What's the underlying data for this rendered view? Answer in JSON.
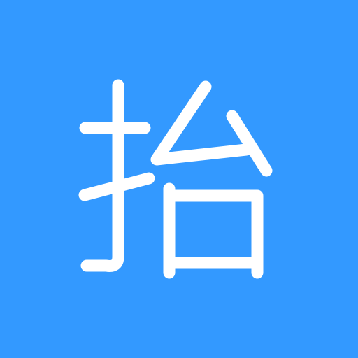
{
  "icon": {
    "background_color": "#3399FF",
    "glyph_color": "#FFFFFF",
    "glyph": "抬"
  }
}
